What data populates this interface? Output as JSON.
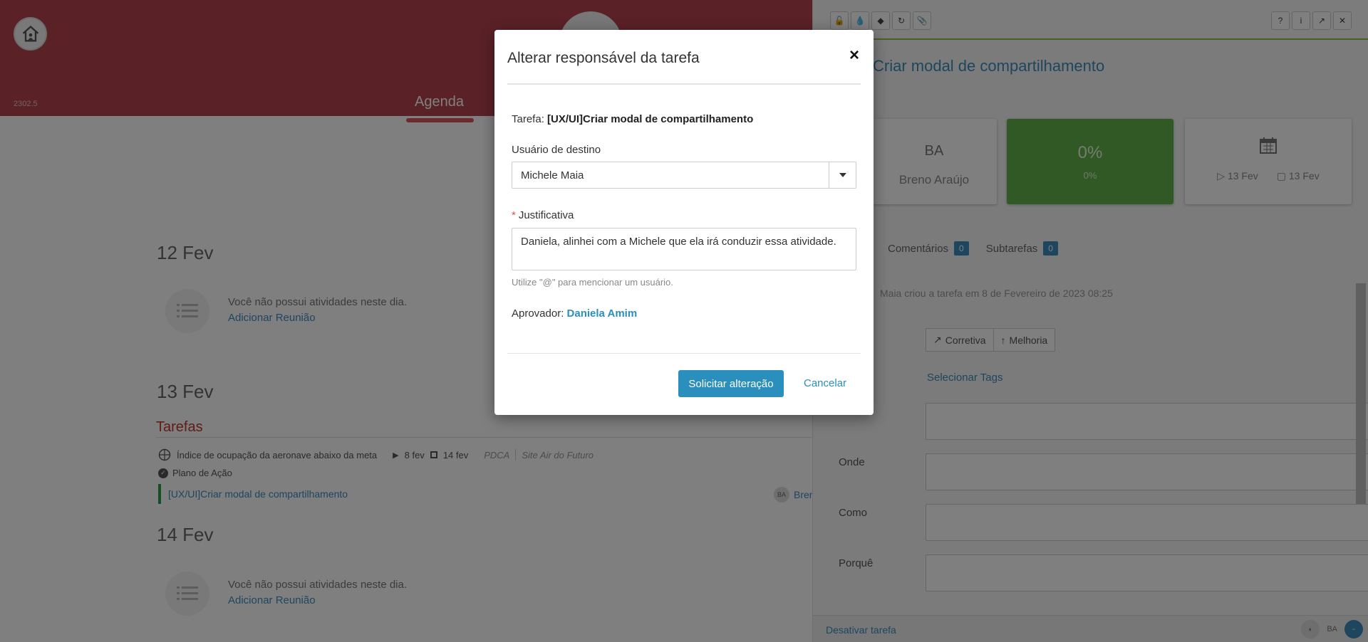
{
  "header": {
    "version": "2302.5",
    "nav_active": "Agenda",
    "colors": {
      "bar": "#b4434f",
      "accent": "#d8545f"
    }
  },
  "agenda": {
    "days": [
      {
        "label": "12 Fev",
        "empty_text": "Você não possui atividades neste dia.",
        "add_link": "Adicionar Reunião"
      },
      {
        "label": "13 Fev"
      },
      {
        "label": "14 Fev",
        "empty_text": "Você não possui atividades neste dia.",
        "add_link": "Adicionar Reunião"
      }
    ],
    "tarefas_title": "Tarefas",
    "task": {
      "goal": "Índice de ocupação da aeronave abaixo da meta",
      "start": "8 fev",
      "end": "14 fev",
      "method": "PDCA",
      "site": "Site Air do Futuro",
      "plan": "Plano de Ação",
      "name": "[UX/UI]Criar modal de compartilhamento",
      "assignee_initials": "BA",
      "assignee_name": "Bren"
    }
  },
  "panel": {
    "title": "Criar modal de compartilhamento",
    "owner_initials": "BA",
    "owner_name": "Breno Araújo",
    "progress": "0%",
    "progress_sub": "0%",
    "date_start": "13 Fev",
    "date_end": "13 Fev",
    "tabs": [
      {
        "label": "Comentários",
        "count": "0"
      },
      {
        "label": "Subtarefas",
        "count": "0"
      }
    ],
    "log": "Maia criou a tarefa em 8 de Fevereiro de 2023 08:25",
    "type_buttons": [
      "Corretiva",
      "Melhoria"
    ],
    "select_tags": "Selecionar Tags",
    "fields": [
      "Onde",
      "Como",
      "Porquê"
    ],
    "footer_link": "Desativar tarefa",
    "footer_initials": "BA",
    "accent": "#63b34a"
  },
  "modal": {
    "title": "Alterar responsável da tarefa",
    "close": "×",
    "task_label": "Tarefa:",
    "task_name": "[UX/UI]Criar modal de compartilhamento",
    "user_label": "Usuário de destino",
    "user_value": "Michele Maia",
    "required_mark": "*",
    "justification_label": "Justificativa",
    "justification_value": "Daniela, alinhei com a Michele que ela irá conduzir essa atividade.",
    "hint": "Utilize \"@\" para mencionar um usuário.",
    "approver_label": "Aprovador:",
    "approver_name": "Daniela Amim",
    "submit": "Solicitar alteração",
    "cancel": "Cancelar",
    "primary_color": "#2a8fbd"
  }
}
